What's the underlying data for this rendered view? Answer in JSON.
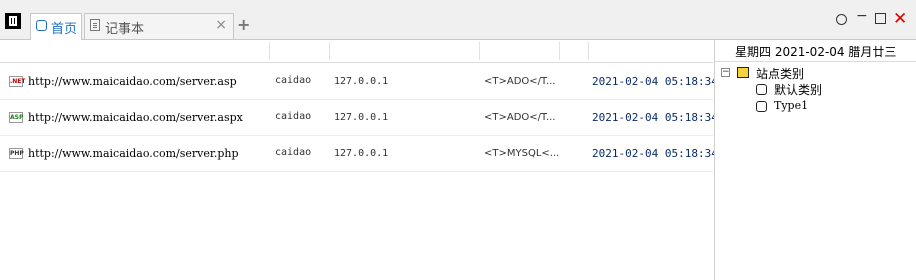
{
  "tabs": [
    {
      "label": "首页",
      "icon": "home-icon"
    },
    {
      "label": "记事本",
      "icon": "notepad-icon"
    }
  ],
  "tab_close_glyph": "×",
  "tab_add_glyph": "+",
  "window_controls": {
    "min": "−",
    "close": "✕"
  },
  "date_bar": "星期四  2021-02-04  腊月廿三",
  "rows": [
    {
      "type": ".NET",
      "url": "http://www.maicaidao.com/server.asp",
      "user": "caidao",
      "ip": "127.0.0.1",
      "note": "<T>ADO</T...",
      "time": "2021-02-04 05:18:34"
    },
    {
      "type": "ASP",
      "url": "http://www.maicaidao.com/server.aspx",
      "user": "caidao",
      "ip": "127.0.0.1",
      "note": "<T>ADO</T...",
      "time": "2021-02-04 05:18:34"
    },
    {
      "type": "PHP",
      "url": "http://www.maicaidao.com/server.php",
      "user": "caidao",
      "ip": "127.0.0.1",
      "note": "<T>MYSQL<...",
      "time": "2021-02-04 05:18:34"
    }
  ],
  "tree": {
    "toggle": "−",
    "root": "站点类别",
    "children": [
      "默认类别",
      "Type1"
    ]
  },
  "colors": {
    "accent": "#1e6fc7",
    "close": "#e00000",
    "time": "#0a2a6a"
  }
}
